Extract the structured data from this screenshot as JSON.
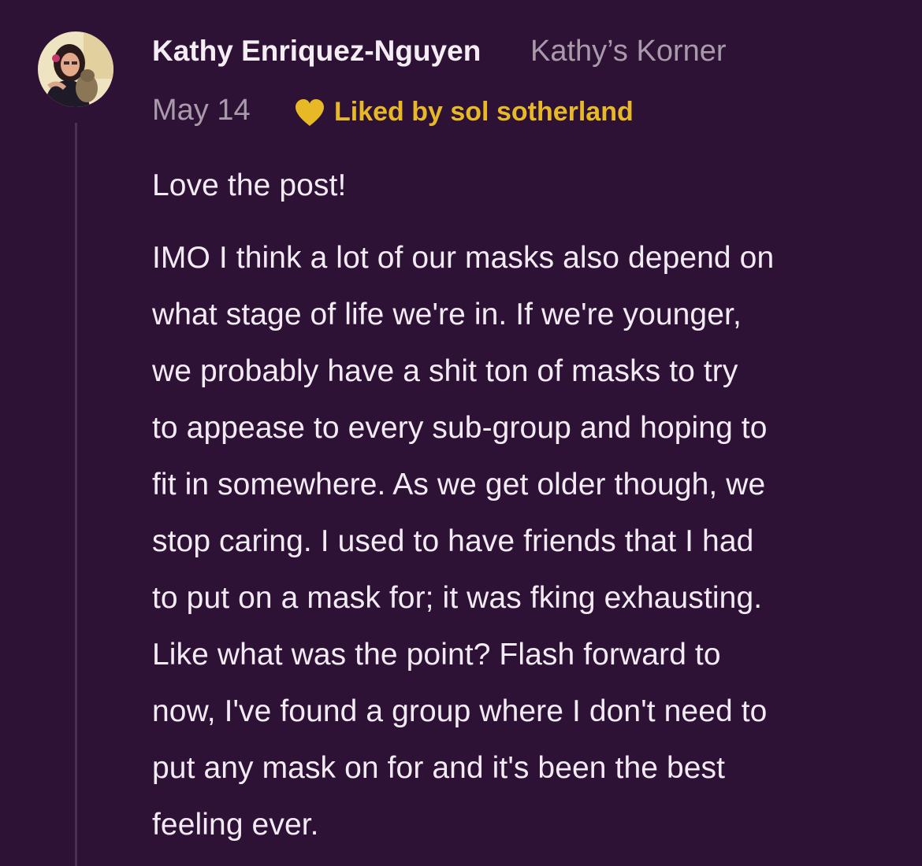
{
  "comment": {
    "author": "Kathy Enriquez-Nguyen",
    "publication": "Kathy’s Korner",
    "date": "May 14",
    "liked_by": "Liked by sol sotherland",
    "paragraphs": [
      [
        "Love the post!"
      ],
      [
        "IMO I think a lot of our masks also depend on",
        "what stage of life we're in. If we're younger,",
        "we probably have a shit ton of masks to try",
        "to appease to every sub-group and hoping to",
        "fit in somewhere. As we get older though, we",
        "stop caring. I used to have friends that I had",
        "to put on a mask for; it was fking exhausting.",
        "Like what was the point? Flash forward to",
        "now, I've found a group where I don't need to",
        "put any mask on for and it's been the best",
        "feeling ever."
      ]
    ]
  },
  "icons": {
    "avatar": "avatar-photo",
    "heart": "heart-icon"
  },
  "colors": {
    "background": "#2e1236",
    "text": "#f2ebf3",
    "muted": "#a89aab",
    "like_accent": "#e8b927",
    "thread_line": "#4a3152"
  }
}
